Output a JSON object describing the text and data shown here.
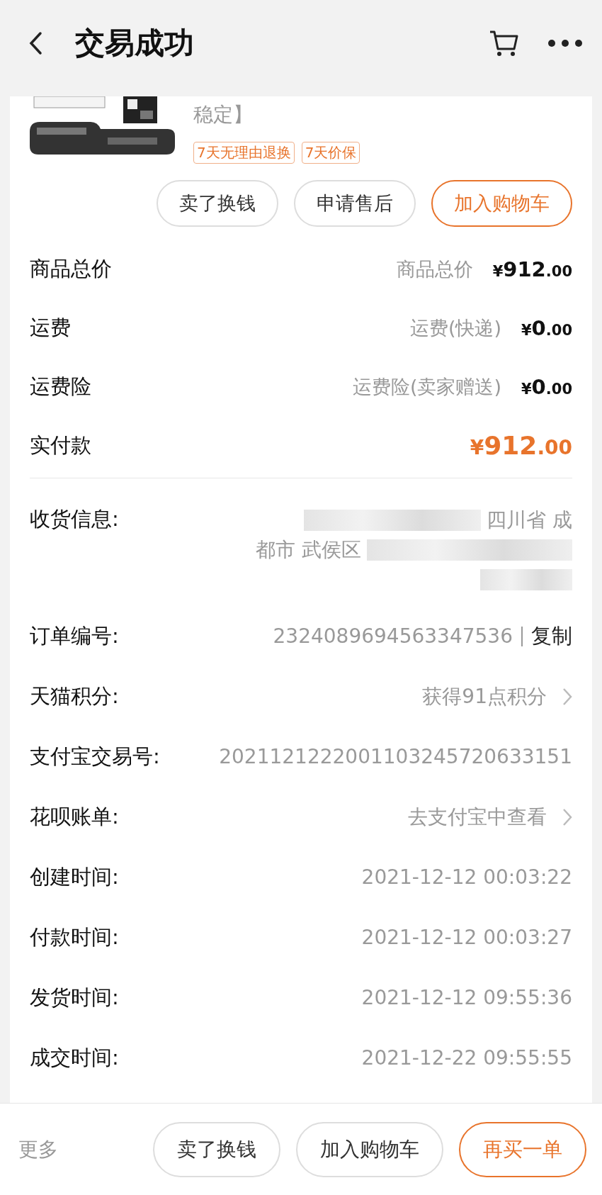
{
  "header": {
    "title": "交易成功"
  },
  "product": {
    "title_tail": "稳定】",
    "tags": [
      "7天无理由退换",
      "7天价保"
    ],
    "buttons": [
      {
        "label": "卖了换钱",
        "primary": false
      },
      {
        "label": "申请售后",
        "primary": false
      },
      {
        "label": "加入购物车",
        "primary": true
      }
    ]
  },
  "price_rows": [
    {
      "label": "商品总价",
      "note": "商品总价",
      "currency": "¥",
      "amount": "912",
      "decimals": ".00",
      "emphasis": false
    },
    {
      "label": "运费",
      "note": "运费(快递)",
      "currency": "¥",
      "amount": "0",
      "decimals": ".00",
      "emphasis": false
    },
    {
      "label": "运费险",
      "note": "运费险(卖家赠送)",
      "currency": "¥",
      "amount": "0",
      "decimals": ".00",
      "emphasis": false
    },
    {
      "label": "实付款",
      "currency": "¥",
      "amount": "912",
      "decimals": ".00",
      "emphasis": true
    }
  ],
  "shipping": {
    "label": "收货信息:",
    "lines": [
      "四川省 成",
      "都市 武侯区"
    ]
  },
  "info_rows": [
    {
      "label": "订单编号:",
      "value": "2324089694563347536",
      "action": "复制",
      "chevron": false
    },
    {
      "label": "天猫积分:",
      "value": "获得91点积分",
      "chevron": true
    },
    {
      "label": "支付宝交易号:",
      "value": "2021121222001103245720633151",
      "chevron": false
    },
    {
      "label": "花呗账单:",
      "value": "去支付宝中查看",
      "chevron": true
    },
    {
      "label": "创建时间:",
      "value": "2021-12-12 00:03:22",
      "chevron": false
    },
    {
      "label": "付款时间:",
      "value": "2021-12-12 00:03:27",
      "chevron": false
    },
    {
      "label": "发货时间:",
      "value": "2021-12-12 09:55:36",
      "chevron": false
    },
    {
      "label": "成交时间:",
      "value": "2021-12-22 09:55:55",
      "chevron": false
    }
  ],
  "bottom_bar": {
    "more": "更多",
    "buttons": [
      {
        "label": "卖了换钱",
        "primary": false
      },
      {
        "label": "加入购物车",
        "primary": false
      },
      {
        "label": "再买一单",
        "primary": true
      }
    ]
  }
}
